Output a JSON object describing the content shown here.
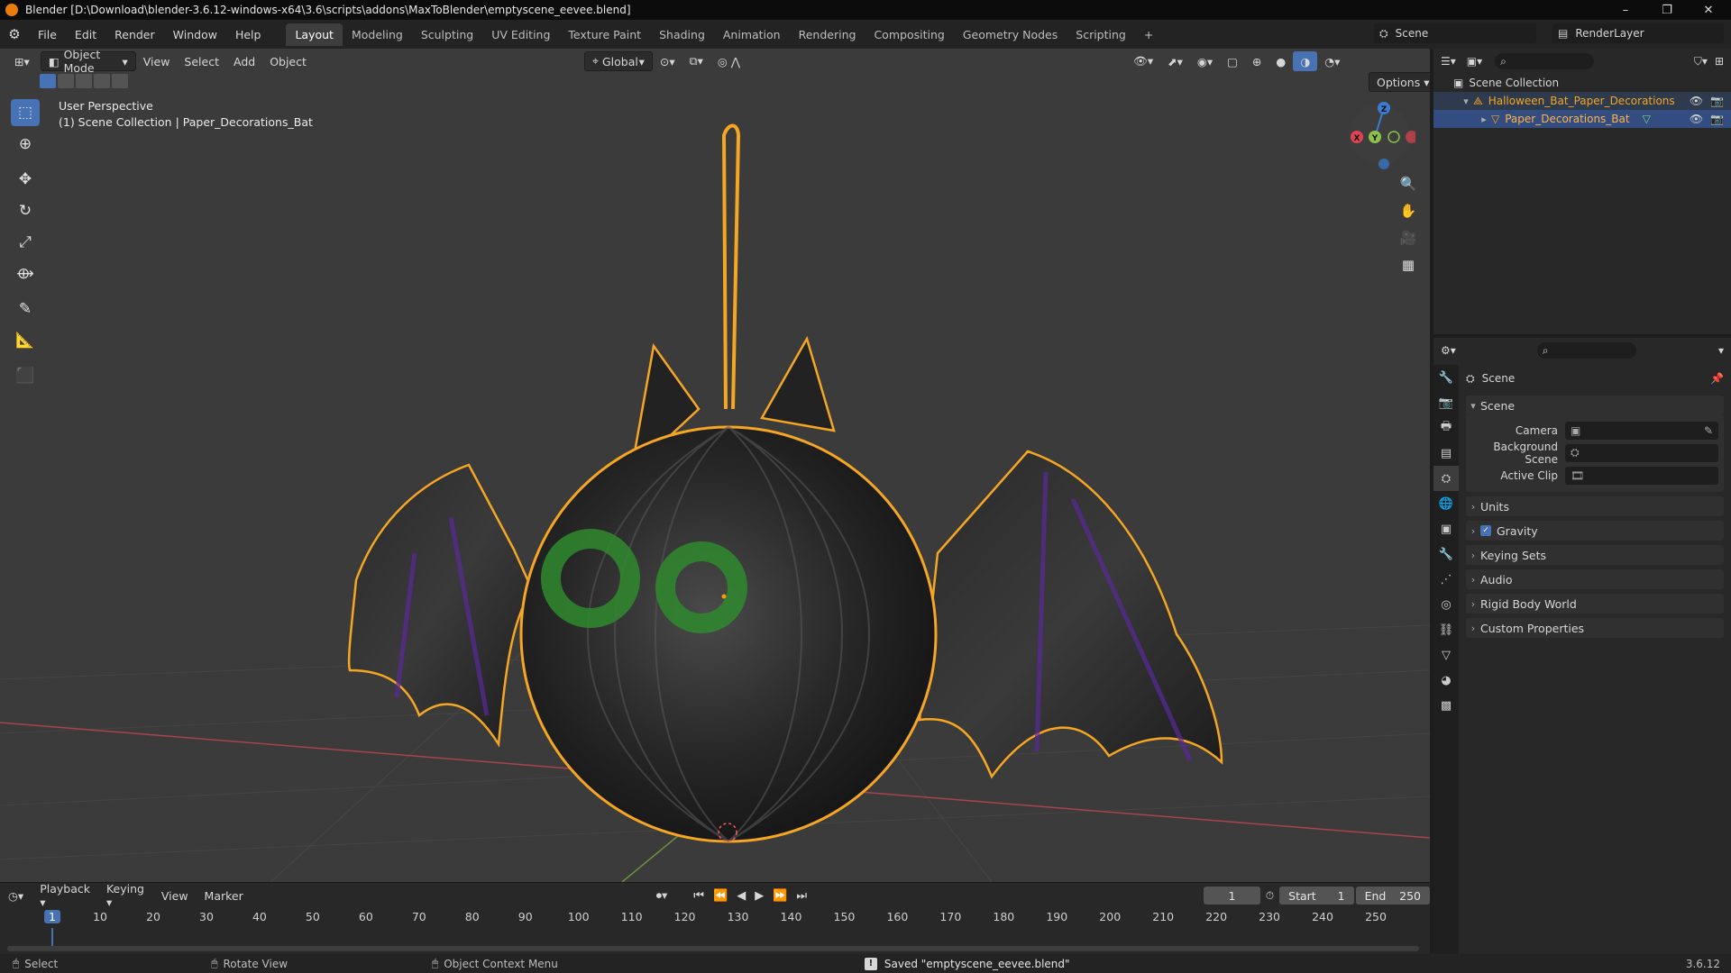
{
  "window": {
    "title": "Blender [D:\\Download\\blender-3.6.12-windows-x64\\3.6\\scripts\\addons\\MaxToBlender\\emptyscene_eevee.blend]",
    "controls": [
      "–",
      "❐",
      "✕"
    ]
  },
  "menu": [
    "File",
    "Edit",
    "Render",
    "Window",
    "Help"
  ],
  "workspaces": [
    "Layout",
    "Modeling",
    "Sculpting",
    "UV Editing",
    "Texture Paint",
    "Shading",
    "Animation",
    "Rendering",
    "Compositing",
    "Geometry Nodes",
    "Scripting",
    "+"
  ],
  "active_workspace": "Layout",
  "scene_selector": {
    "label": "Scene"
  },
  "view_layer_selector": {
    "label": "RenderLayer"
  },
  "viewport": {
    "mode": "Object Mode",
    "header_menus": [
      "View",
      "Select",
      "Add",
      "Object"
    ],
    "orientation": "Global",
    "options_label": "Options",
    "info_line1": "User Perspective",
    "info_line2": "(1) Scene Collection | Paper_Decorations_Bat",
    "gizmo_axes": {
      "x": "X",
      "y": "Y",
      "z": "Z"
    }
  },
  "timeline": {
    "menus": [
      "Playback",
      "Keying",
      "View",
      "Marker"
    ],
    "current_frame": "1",
    "start_label": "Start",
    "start_value": "1",
    "end_label": "End",
    "end_value": "250",
    "ruler_ticks": [
      "1",
      "10",
      "20",
      "30",
      "40",
      "50",
      "60",
      "70",
      "80",
      "90",
      "100",
      "110",
      "120",
      "130",
      "140",
      "150",
      "160",
      "170",
      "180",
      "190",
      "200",
      "210",
      "220",
      "230",
      "240",
      "250"
    ],
    "playhead_frame": "1"
  },
  "statusbar": {
    "select": "Select",
    "rotate": "Rotate View",
    "context": "Object Context Menu",
    "message": "Saved \"emptyscene_eevee.blend\"",
    "version": "3.6.12"
  },
  "outliner": {
    "root": "Scene Collection",
    "items": [
      {
        "name": "Halloween_Bat_Paper_Decorations"
      },
      {
        "name": "Paper_Decorations_Bat"
      }
    ]
  },
  "properties": {
    "context_title": "Scene",
    "panel_title": "Scene",
    "fields": [
      {
        "label": "Camera",
        "value": ""
      },
      {
        "label": "Background Scene",
        "value": ""
      },
      {
        "label": "Active Clip",
        "value": ""
      }
    ],
    "subpanels": [
      "Units",
      "Gravity",
      "Keying Sets",
      "Audio",
      "Rigid Body World",
      "Custom Properties"
    ],
    "gravity_checked": true
  },
  "colors": {
    "accent_blue": "#4772b3",
    "selection_orange": "#f5a623",
    "axis_x": "#e0434f",
    "axis_y": "#8bc34a",
    "axis_z": "#3a7bd5"
  }
}
